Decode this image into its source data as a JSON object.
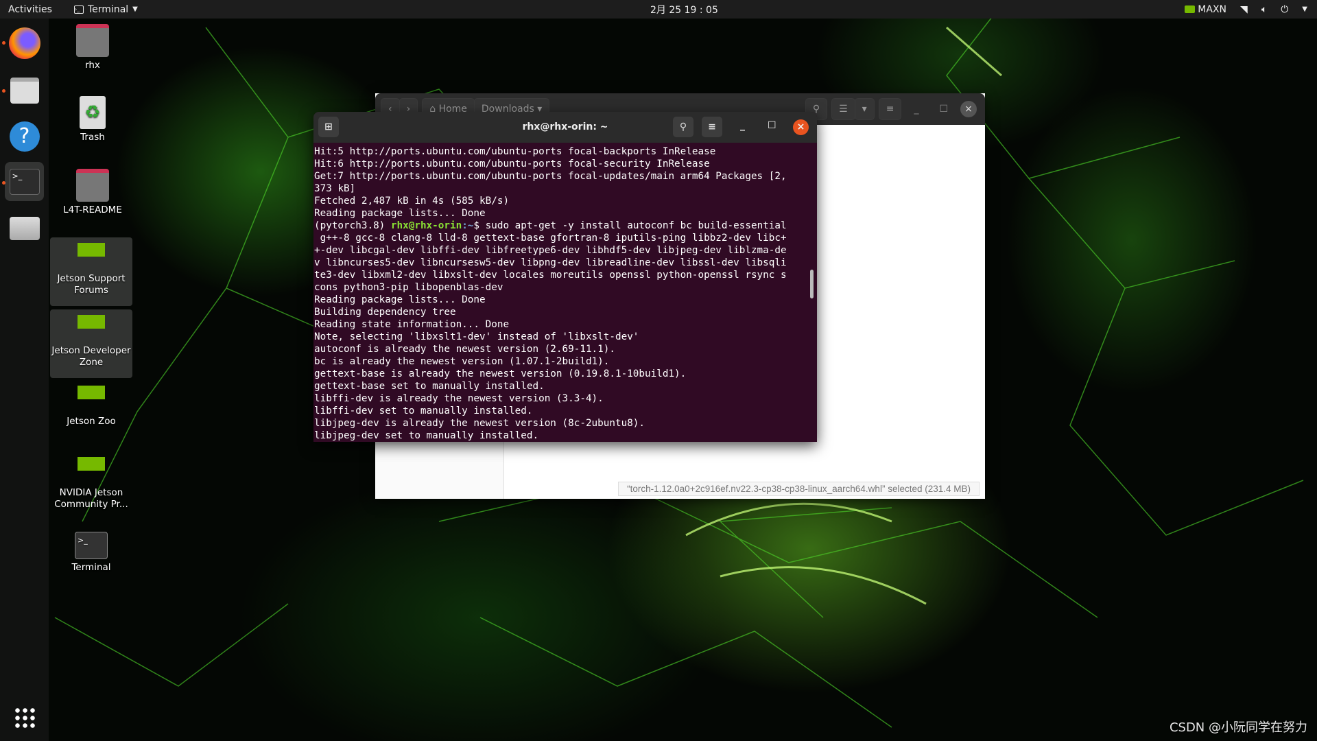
{
  "topbar": {
    "activities": "Activities",
    "app": "Terminal",
    "clock": "2月 25 19 : 05",
    "power_mode": "MAXN"
  },
  "dock": {
    "items": [
      {
        "name": "Firefox",
        "icon": "firefox-icon"
      },
      {
        "name": "Files",
        "icon": "files-icon"
      },
      {
        "name": "Help",
        "icon": "help-icon"
      },
      {
        "name": "Terminal",
        "icon": "terminal-icon"
      },
      {
        "name": "Disk",
        "icon": "disk-icon"
      }
    ],
    "apps_grid": "show-applications-icon"
  },
  "desktop": {
    "items": [
      "rhx",
      "Trash",
      "L4T-README",
      "Jetson Support Forums",
      "Jetson Developer Zone",
      "Jetson Zoo",
      "NVIDIA Jetson Community Pr...",
      "Terminal"
    ]
  },
  "files": {
    "path": [
      "Home",
      "Downloads"
    ],
    "status": "“torch-1.12.0a0+2c916ef.nv22.3-cp38-cp38-linux_aarch64.whl” selected  (231.4 MB)"
  },
  "terminal": {
    "title": "rhx@rhx-orin: ~",
    "prompt_env": "(pytorch3.8) ",
    "prompt_user": "rhx@rhx-orin",
    "prompt_path": ":~",
    "prompt_cmd": "$ sudo apt-get -y install autoconf bc build-essential",
    "lines_before": [
      "Hit:5 http://ports.ubuntu.com/ubuntu-ports focal-backports InRelease",
      "Hit:6 http://ports.ubuntu.com/ubuntu-ports focal-security InRelease",
      "Get:7 http://ports.ubuntu.com/ubuntu-ports focal-updates/main arm64 Packages [2,",
      "373 kB]",
      "Fetched 2,487 kB in 4s (585 kB/s)",
      "Reading package lists... Done"
    ],
    "lines_after": [
      " g++-8 gcc-8 clang-8 lld-8 gettext-base gfortran-8 iputils-ping libbz2-dev libc+",
      "+-dev libcgal-dev libffi-dev libfreetype6-dev libhdf5-dev libjpeg-dev liblzma-de",
      "v libncurses5-dev libncursesw5-dev libpng-dev libreadline-dev libssl-dev libsqli",
      "te3-dev libxml2-dev libxslt-dev locales moreutils openssl python-openssl rsync s",
      "cons python3-pip libopenblas-dev",
      "Reading package lists... Done",
      "Building dependency tree",
      "Reading state information... Done",
      "Note, selecting 'libxslt1-dev' instead of 'libxslt-dev'",
      "autoconf is already the newest version (2.69-11.1).",
      "bc is already the newest version (1.07.1-2build1).",
      "gettext-base is already the newest version (0.19.8.1-10build1).",
      "gettext-base set to manually installed.",
      "libffi-dev is already the newest version (3.3-4).",
      "libffi-dev set to manually installed.",
      "libjpeg-dev is already the newest version (8c-2ubuntu8).",
      "libjpeg-dev set to manually installed."
    ]
  },
  "watermark": "CSDN @小阮同学在努力",
  "colors": {
    "terminal_bg": "#300a24",
    "accent": "#e95420",
    "prompt_green": "#8ae234",
    "nvidia_green": "#76b900"
  }
}
